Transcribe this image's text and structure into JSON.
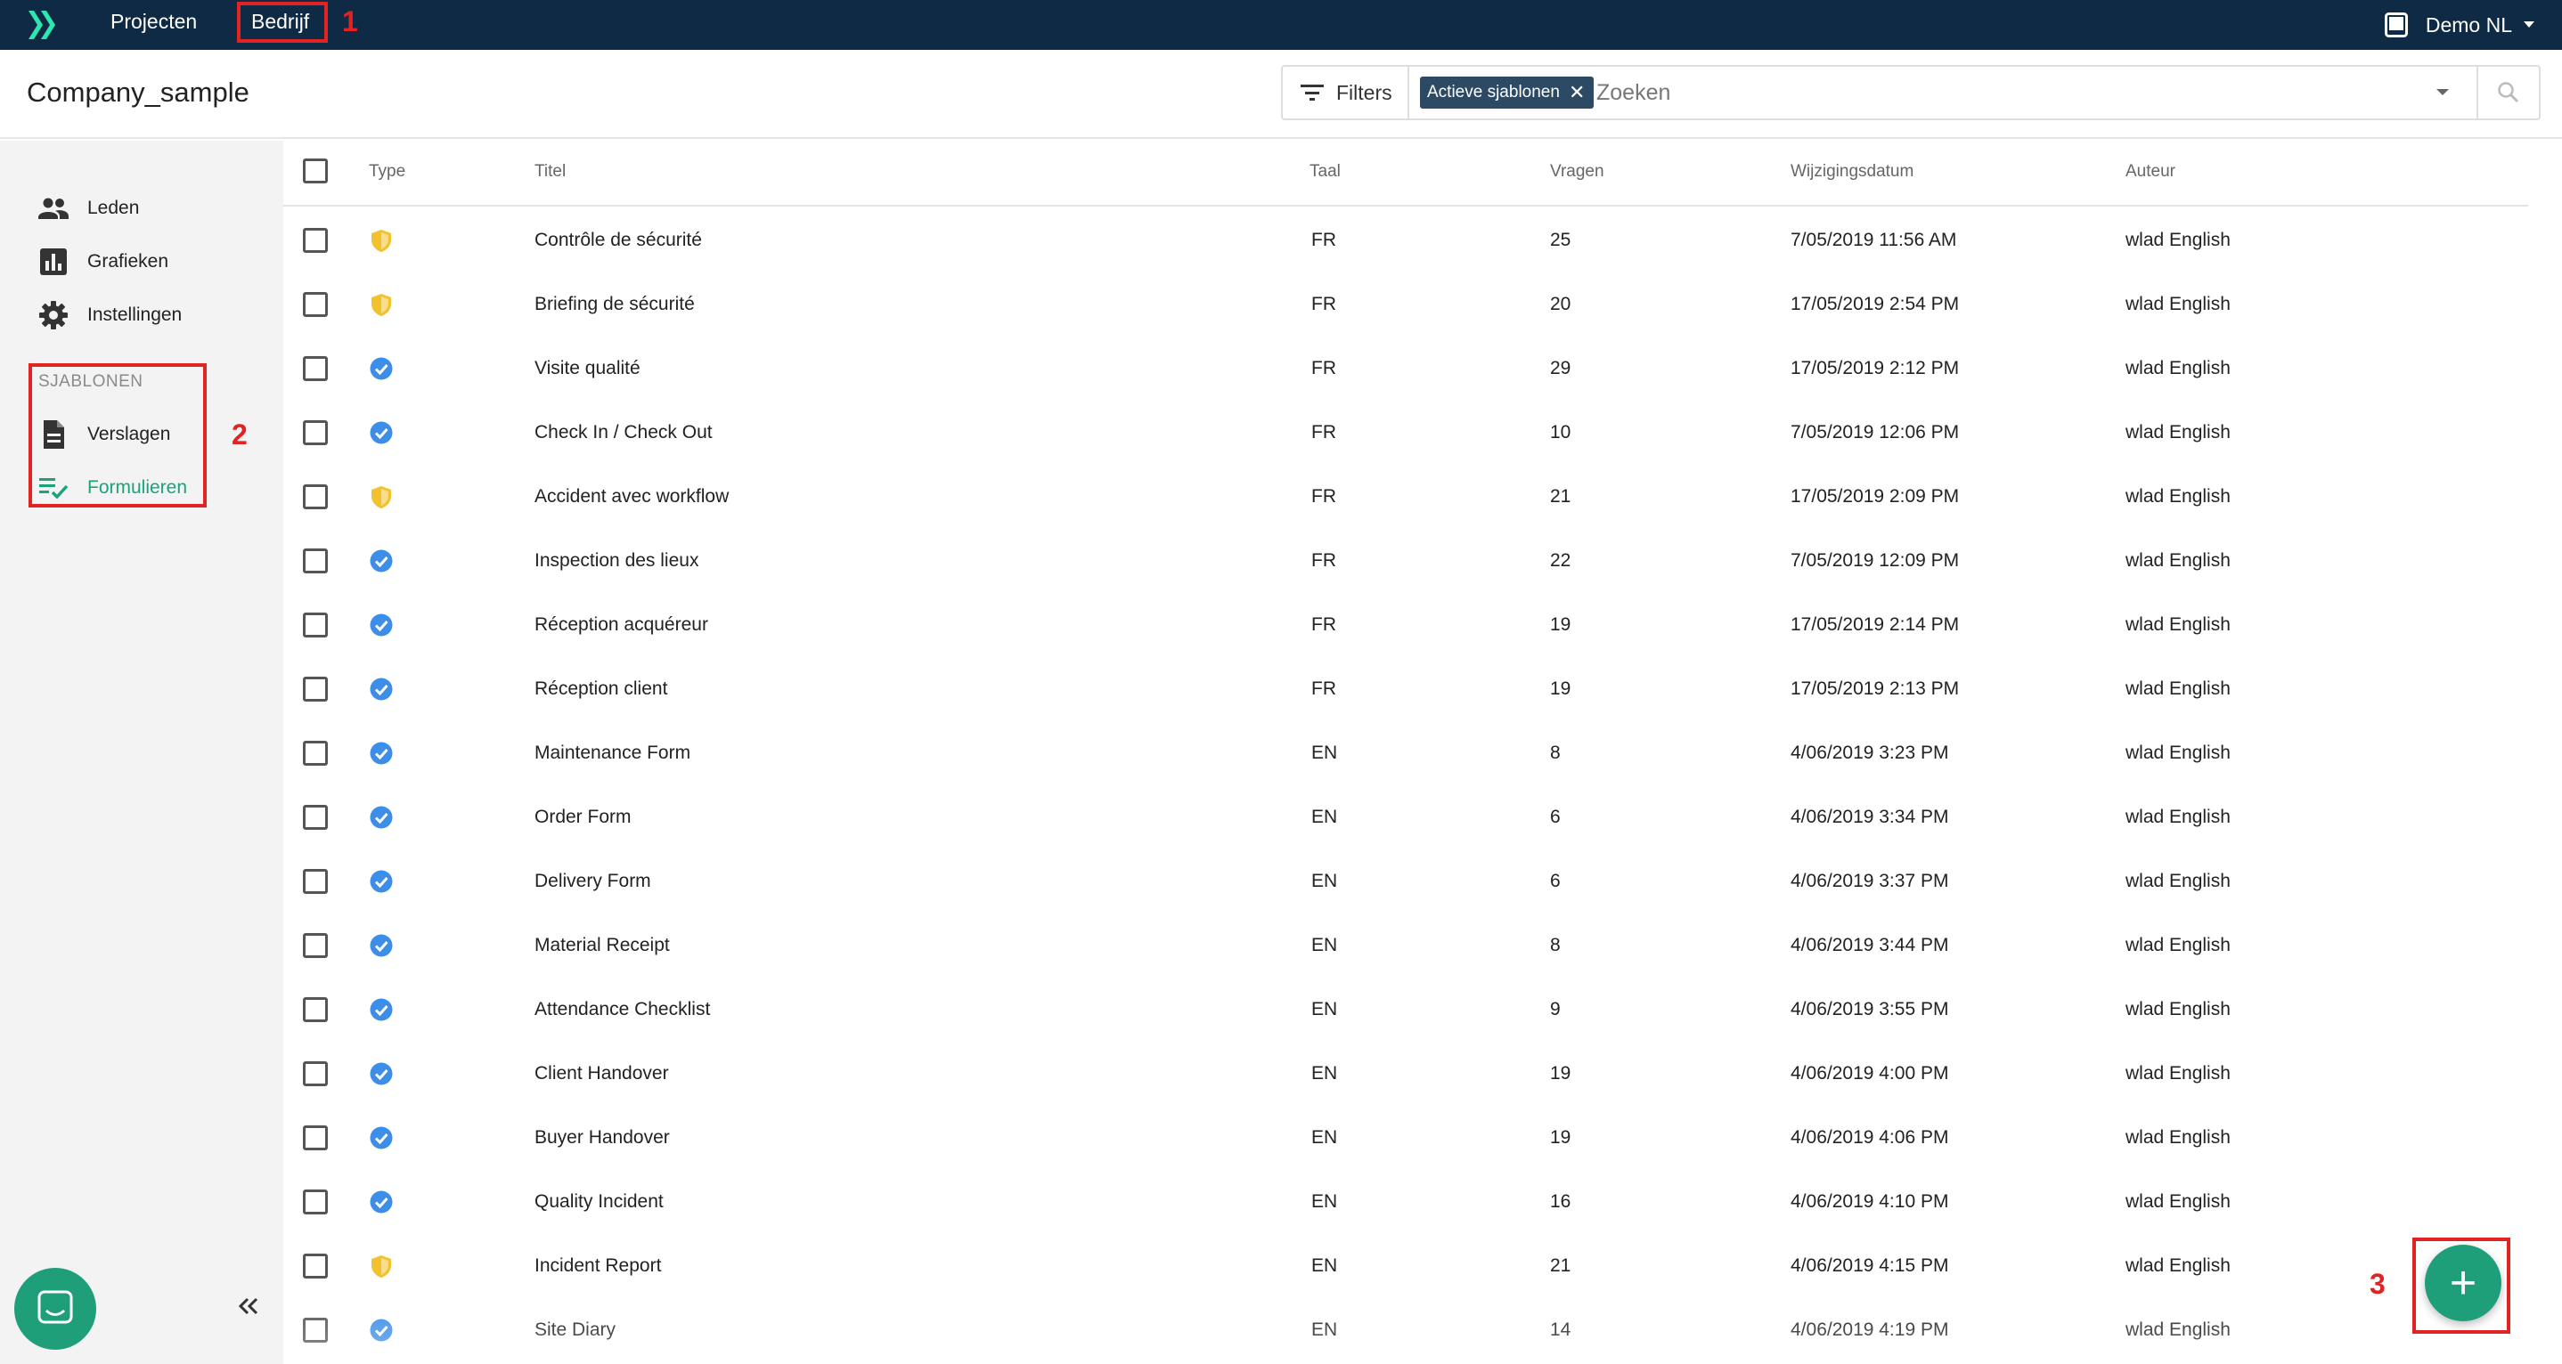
{
  "topbar": {
    "logo_icon": "double-chevron-right-logo",
    "nav": [
      {
        "label": "Projecten"
      },
      {
        "label": "Bedrijf"
      }
    ],
    "user_label": "Demo NL",
    "user_icon": "tablet-icon",
    "colors": {
      "background": "#0f2a44",
      "logo": "#2ee6b0"
    }
  },
  "header": {
    "title": "Company_sample",
    "filters_label": "Filters",
    "active_chip": "Actieve sjablonen",
    "search_placeholder": "Zoeken"
  },
  "sidebar": {
    "items": [
      {
        "label": "Leden",
        "icon": "people-icon"
      },
      {
        "label": "Grafieken",
        "icon": "bar-chart-icon"
      },
      {
        "label": "Instellingen",
        "icon": "gear-icon"
      }
    ],
    "section_label": "SJABLONEN",
    "template_items": [
      {
        "label": "Verslagen",
        "icon": "document-icon"
      },
      {
        "label": "Formulieren",
        "icon": "checklist-icon",
        "active": true
      }
    ],
    "accent_color": "#1aa37a"
  },
  "annotations": [
    "1",
    "2",
    "3"
  ],
  "table": {
    "columns": [
      "Type",
      "Titel",
      "Taal",
      "Vragen",
      "Wijzigingsdatum",
      "Auteur"
    ],
    "rows": [
      {
        "type": "shield",
        "title": "Contrôle de sécurité",
        "lang": "FR",
        "questions": "25",
        "date": "7/05/2019 11:56 AM",
        "author": "wlad English"
      },
      {
        "type": "shield",
        "title": "Briefing de sécurité",
        "lang": "FR",
        "questions": "20",
        "date": "17/05/2019 2:54 PM",
        "author": "wlad English"
      },
      {
        "type": "verified",
        "title": "Visite qualité",
        "lang": "FR",
        "questions": "29",
        "date": "17/05/2019 2:12 PM",
        "author": "wlad English"
      },
      {
        "type": "verified",
        "title": "Check In / Check Out",
        "lang": "FR",
        "questions": "10",
        "date": "7/05/2019 12:06 PM",
        "author": "wlad English"
      },
      {
        "type": "shield",
        "title": "Accident avec workflow",
        "lang": "FR",
        "questions": "21",
        "date": "17/05/2019 2:09 PM",
        "author": "wlad English"
      },
      {
        "type": "verified",
        "title": "Inspection des lieux",
        "lang": "FR",
        "questions": "22",
        "date": "7/05/2019 12:09 PM",
        "author": "wlad English"
      },
      {
        "type": "verified",
        "title": "Réception acquéreur",
        "lang": "FR",
        "questions": "19",
        "date": "17/05/2019 2:14 PM",
        "author": "wlad English"
      },
      {
        "type": "verified",
        "title": "Réception client",
        "lang": "FR",
        "questions": "19",
        "date": "17/05/2019 2:13 PM",
        "author": "wlad English"
      },
      {
        "type": "verified",
        "title": "Maintenance Form",
        "lang": "EN",
        "questions": "8",
        "date": "4/06/2019 3:23 PM",
        "author": "wlad English"
      },
      {
        "type": "verified",
        "title": "Order Form",
        "lang": "EN",
        "questions": "6",
        "date": "4/06/2019 3:34 PM",
        "author": "wlad English"
      },
      {
        "type": "verified",
        "title": "Delivery Form",
        "lang": "EN",
        "questions": "6",
        "date": "4/06/2019 3:37 PM",
        "author": "wlad English"
      },
      {
        "type": "verified",
        "title": "Material Receipt",
        "lang": "EN",
        "questions": "8",
        "date": "4/06/2019 3:44 PM",
        "author": "wlad English"
      },
      {
        "type": "verified",
        "title": "Attendance Checklist",
        "lang": "EN",
        "questions": "9",
        "date": "4/06/2019 3:55 PM",
        "author": "wlad English"
      },
      {
        "type": "verified",
        "title": "Client Handover",
        "lang": "EN",
        "questions": "19",
        "date": "4/06/2019 4:00 PM",
        "author": "wlad English"
      },
      {
        "type": "verified",
        "title": "Buyer Handover",
        "lang": "EN",
        "questions": "19",
        "date": "4/06/2019 4:06 PM",
        "author": "wlad English"
      },
      {
        "type": "verified",
        "title": "Quality Incident",
        "lang": "EN",
        "questions": "16",
        "date": "4/06/2019 4:10 PM",
        "author": "wlad English"
      },
      {
        "type": "shield",
        "title": "Incident Report",
        "lang": "EN",
        "questions": "21",
        "date": "4/06/2019 4:15 PM",
        "author": "wlad English"
      },
      {
        "type": "verified",
        "title": "Site Diary",
        "lang": "EN",
        "questions": "14",
        "date": "4/06/2019 4:19 PM",
        "author": "wlad English"
      }
    ],
    "type_colors": {
      "shield": "#f2c12e",
      "verified": "#3d8ee8"
    }
  },
  "fab": {
    "label": "+",
    "color": "#1f9e7a"
  }
}
